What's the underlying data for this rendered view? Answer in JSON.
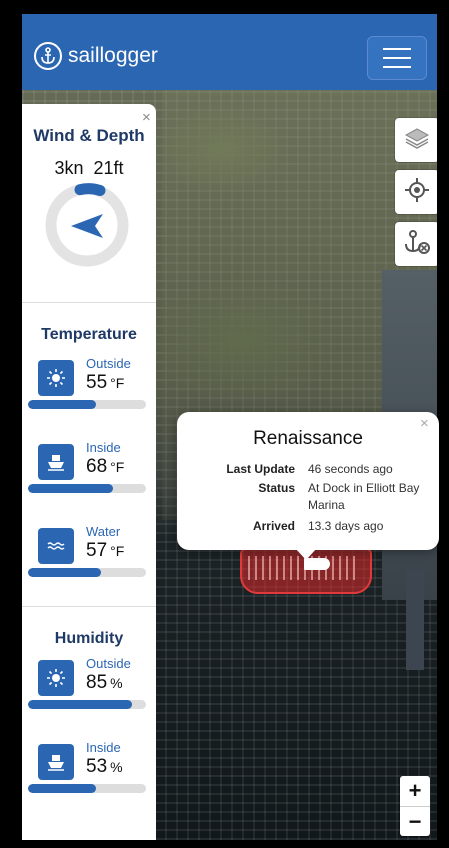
{
  "app": {
    "title": "saillogger"
  },
  "nav": {
    "menu_icon": "hamburger-icon",
    "logo_icon": "anchor-icon"
  },
  "wind_depth": {
    "title": "Wind & Depth",
    "close": "×",
    "wind": "3kn",
    "depth": "21ft"
  },
  "temperature": {
    "title": "Temperature",
    "sensors": [
      {
        "label": "Outside",
        "value": "55",
        "unit": "°F",
        "icon": "sun-icon",
        "level": 0.58
      },
      {
        "label": "Inside",
        "value": "68",
        "unit": "°F",
        "icon": "boat-icon",
        "level": 0.72
      },
      {
        "label": "Water",
        "value": "57",
        "unit": "°F",
        "icon": "waves-icon",
        "level": 0.62
      }
    ]
  },
  "humidity": {
    "title": "Humidity",
    "sensors": [
      {
        "label": "Outside",
        "value": "85",
        "unit": "%",
        "icon": "sun-icon",
        "level": 0.88
      },
      {
        "label": "Inside",
        "value": "53",
        "unit": "%",
        "icon": "boat-icon",
        "level": 0.58
      }
    ]
  },
  "popup": {
    "title": "Renaissance",
    "close": "×",
    "last_update_label": "Last Update",
    "last_update_value": "46 seconds ago",
    "status_label": "Status",
    "status_value": "At Dock in Elliott Bay Marina",
    "arrived_label": "Arrived",
    "arrived_value": "13.3 days ago"
  },
  "map_controls": {
    "layers_icon": "layers-icon",
    "locate_icon": "locate-icon",
    "anchor_off_icon": "anchor-off-icon",
    "zoom_in": "+",
    "zoom_out": "−"
  },
  "colors": {
    "brand": "#2b66b3",
    "marina": "#e23a3a"
  }
}
